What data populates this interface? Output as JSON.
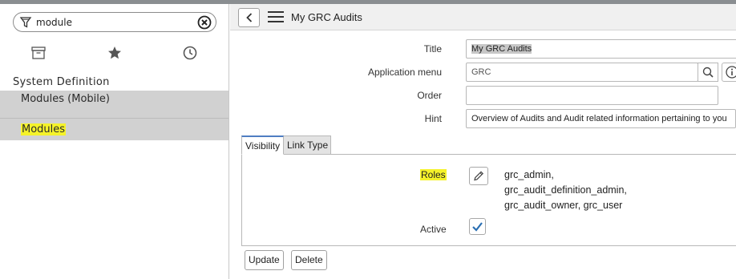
{
  "nav": {
    "filter_value": "module",
    "tabs": [
      {
        "icon": "archive-icon"
      },
      {
        "icon": "star-icon"
      },
      {
        "icon": "clock-icon"
      }
    ],
    "application": "System Definition",
    "modules": [
      {
        "label": "Modules (Mobile)",
        "highlighted": false
      },
      {
        "label": "Modules",
        "highlighted": true
      }
    ]
  },
  "header": {
    "title": "My GRC Audits"
  },
  "form": {
    "title": {
      "label": "Title",
      "value": "My GRC Audits"
    },
    "application_menu": {
      "label": "Application menu",
      "value": "GRC"
    },
    "order": {
      "label": "Order",
      "value": ""
    },
    "hint": {
      "label": "Hint",
      "value": "Overview of Audits and Audit related information pertaining to you"
    }
  },
  "tabs": [
    "Visibility",
    "Link Type"
  ],
  "visibility": {
    "roles_label": "Roles",
    "roles": [
      "grc_admin,",
      "grc_audit_definition_admin,",
      "grc_audit_owner, grc_user"
    ],
    "active_label": "Active",
    "active": true
  },
  "buttons": {
    "update": "Update",
    "delete": "Delete"
  },
  "colors": {
    "highlight": "#f5f22a",
    "selected_row": "#d1d1d1",
    "check": "#2a6fb3",
    "tab_accent": "#4f7ec2"
  }
}
